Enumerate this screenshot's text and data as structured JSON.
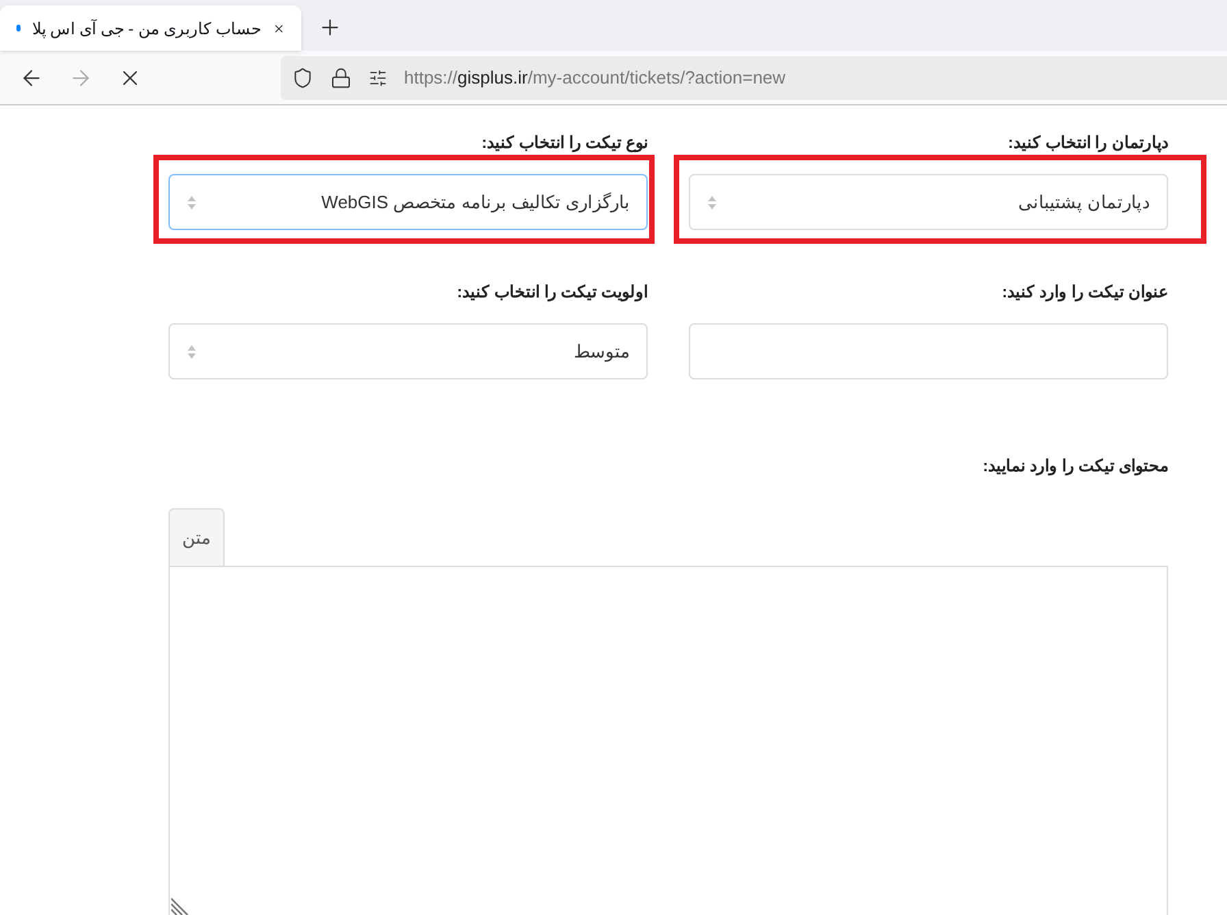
{
  "browser": {
    "tab": {
      "title": "حساب کاربری من - جی آی اس پلا",
      "loading": true
    },
    "url": {
      "scheme": "https://",
      "host": "gisplus.ir",
      "path": "/my-account/tickets/?action=new"
    }
  },
  "form": {
    "fields": [
      {
        "kind": "select",
        "label": "دپارتمان را انتخاب کنید:",
        "value": "دپارتمان پشتیبانی",
        "highlighted": true,
        "focused": false
      },
      {
        "kind": "select",
        "label": "نوع تیکت را انتخاب کنید:",
        "value": "بارگزاری تکالیف برنامه متخصص WebGIS",
        "highlighted": true,
        "focused": true
      },
      {
        "kind": "text",
        "label": "عنوان تیکت را وارد کنید:",
        "highlighted": false,
        "focused": false
      },
      {
        "kind": "select",
        "label": "اولویت تیکت را انتخاب کنید:",
        "value": "متوسط",
        "highlighted": false,
        "focused": false
      }
    ],
    "content": {
      "label": "محتوای تیکت را وارد نمایید:",
      "tabs": [
        {
          "label": "متن",
          "selected": true
        }
      ]
    }
  }
}
